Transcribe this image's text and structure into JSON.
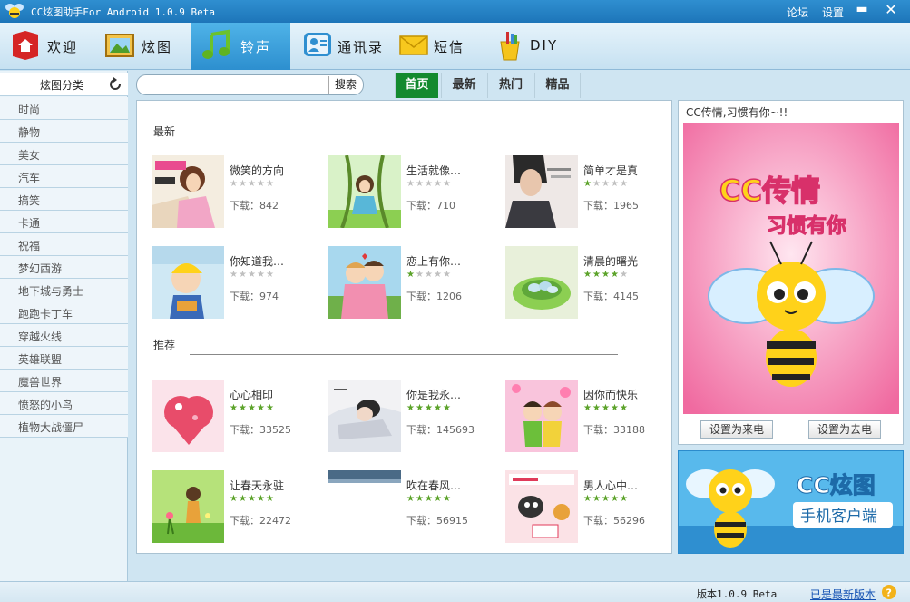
{
  "window": {
    "title": "CC炫图助手For Android 1.0.9 Beta",
    "links": [
      "论坛",
      "设置"
    ],
    "minimize": "▬",
    "close": "✕"
  },
  "nav": [
    {
      "label": "欢迎",
      "icon": "home-icon"
    },
    {
      "label": "炫图",
      "icon": "picture-icon"
    },
    {
      "label": "铃声",
      "icon": "music-note-icon"
    },
    {
      "label": "通讯录",
      "icon": "contacts-icon"
    },
    {
      "label": "短信",
      "icon": "envelope-icon"
    },
    {
      "label": "DIY",
      "icon": "paint-bucket-icon"
    }
  ],
  "sidebar": {
    "title": "炫图分类",
    "items": [
      "时尚",
      "静物",
      "美女",
      "汽车",
      "搞笑",
      "卡通",
      "祝福",
      "梦幻西游",
      "地下城与勇士",
      "跑跑卡丁车",
      "穿越火线",
      "英雄联盟",
      "魔兽世界",
      "愤怒的小鸟",
      "植物大战僵尸"
    ]
  },
  "search": {
    "value": "",
    "placeholder": "",
    "button": "搜索"
  },
  "tabs": [
    {
      "label": "首页",
      "active": true
    },
    {
      "label": "最新",
      "active": false
    },
    {
      "label": "热门",
      "active": false
    },
    {
      "label": "精品",
      "active": false
    }
  ],
  "sections": {
    "latest": {
      "label": "最新",
      "items": [
        {
          "title": "微笑的方向",
          "rating": 0,
          "downloads_label": "下载：842"
        },
        {
          "title": "生活就像…",
          "rating": 0,
          "downloads_label": "下载：710"
        },
        {
          "title": "简单才是真",
          "rating": 1,
          "downloads_label": "下载：1965"
        },
        {
          "title": "你知道我…",
          "rating": 0,
          "downloads_label": "下载：974"
        },
        {
          "title": "恋上有你…",
          "rating": 1,
          "downloads_label": "下载：1206"
        },
        {
          "title": "清晨的曙光",
          "rating": 4,
          "downloads_label": "下载：4145"
        }
      ]
    },
    "recommended": {
      "label": "推荐",
      "items": [
        {
          "title": "心心相印",
          "rating": 5,
          "downloads_label": "下载：33525"
        },
        {
          "title": "你是我永…",
          "rating": 5,
          "downloads_label": "下载：145693"
        },
        {
          "title": "因你而快乐",
          "rating": 5,
          "downloads_label": "下载：33188"
        },
        {
          "title": "让春天永驻",
          "rating": 5,
          "downloads_label": "下载：22472"
        },
        {
          "title": "吹在春风…",
          "rating": 5,
          "downloads_label": "下载：56915"
        },
        {
          "title": "男人心中…",
          "rating": 5,
          "downloads_label": "下载：56296"
        }
      ]
    }
  },
  "right_panel": {
    "title": "CC传情,习惯有你~!!",
    "image_text": [
      "CC传情",
      "习惯有你"
    ],
    "set_incoming": "设置为来电",
    "set_outgoing": "设置为去电"
  },
  "banner": {
    "line1": "CC炫图",
    "line2": "手机客户端"
  },
  "status": {
    "version": "版本1.0.9 Beta",
    "update": "已是最新版本"
  },
  "colors": {
    "titlebar": "#1d75b9",
    "nav_active": "#2d8fcf",
    "tab_active": "#138a2f",
    "star_on": "#5ca32a"
  }
}
